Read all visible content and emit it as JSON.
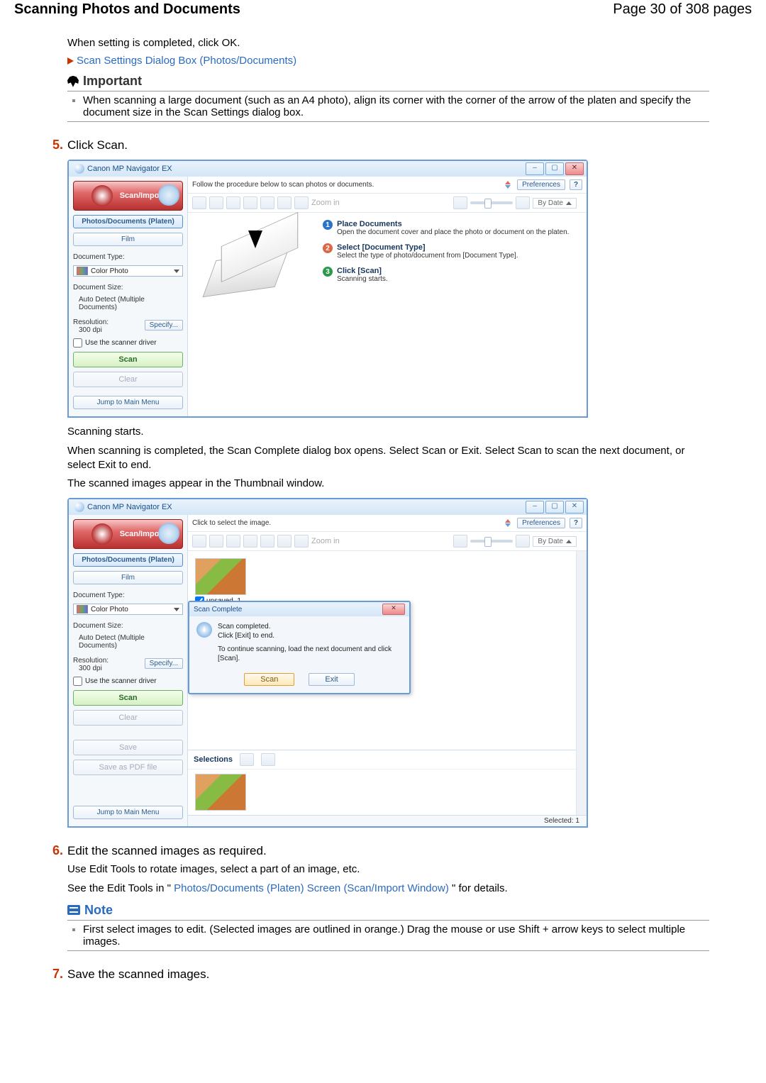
{
  "header": {
    "title": "Scanning Photos and Documents",
    "page_indicator": "Page 30 of 308 pages"
  },
  "intro": {
    "line1": "When setting is completed, click OK.",
    "link1": "Scan Settings Dialog Box (Photos/Documents)"
  },
  "important": {
    "label": "Important",
    "text": "When scanning a large document (such as an A4 photo), align its corner with the corner of the arrow of the platen and specify the document size in the Scan Settings dialog box."
  },
  "step5": {
    "num": "5.",
    "text": "Click Scan."
  },
  "app1": {
    "title": "Canon MP Navigator EX",
    "scan_import": "Scan/Import",
    "tab_photos": "Photos/Documents (Platen)",
    "tab_film": "Film",
    "label_doctype": "Document Type:",
    "doctype_value": "Color Photo",
    "label_docsize": "Document Size:",
    "docsize_value": "Auto Detect (Multiple Documents)",
    "label_res": "Resolution:",
    "res_value": "300 dpi",
    "specify": "Specify...",
    "use_driver": "Use the scanner driver",
    "btn_scan": "Scan",
    "btn_clear": "Clear",
    "btn_jump": "Jump to Main Menu",
    "instruction": "Follow the procedure below to scan photos or documents.",
    "preferences": "Preferences",
    "help": "?",
    "zoom": "Zoom in",
    "sort": "By Date",
    "guide": {
      "t1": "Place Documents",
      "d1": "Open the document cover and place the photo or document on the platen.",
      "t2": "Select [Document Type]",
      "d2": "Select the type of photo/document from [Document Type].",
      "t3": "Click [Scan]",
      "d3": "Scanning starts."
    }
  },
  "after1": {
    "p1": "Scanning starts.",
    "p2": "When scanning is completed, the Scan Complete dialog box opens. Select Scan or Exit. Select Scan to scan the next document, or select Exit to end.",
    "p3": "The scanned images appear in the Thumbnail window."
  },
  "app2": {
    "title": "Canon MP Navigator EX",
    "instruction": "Click to select the image.",
    "thumb_label": "unsaved_1",
    "dlg_title": "Scan Complete",
    "dlg_line1": "Scan completed.",
    "dlg_line2": "Click [Exit] to end.",
    "dlg_line3": "To continue scanning, load the next document and click [Scan].",
    "dlg_scan": "Scan",
    "dlg_exit": "Exit",
    "selections": "Selections",
    "btn_save": "Save",
    "btn_savepdf": "Save as PDF file",
    "status": "Selected: 1"
  },
  "step6": {
    "num": "6.",
    "text": "Edit the scanned images as required.",
    "p1": "Use Edit Tools to rotate images, select a part of an image, etc.",
    "p2a": "See the Edit Tools in \"",
    "p2link": "Photos/Documents (Platen) Screen (Scan/Import Window)",
    "p2b": "\" for details."
  },
  "note": {
    "label": "Note",
    "text": "First select images to edit. (Selected images are outlined in orange.) Drag the mouse or use Shift + arrow keys to select multiple images."
  },
  "step7": {
    "num": "7.",
    "text": "Save the scanned images."
  }
}
